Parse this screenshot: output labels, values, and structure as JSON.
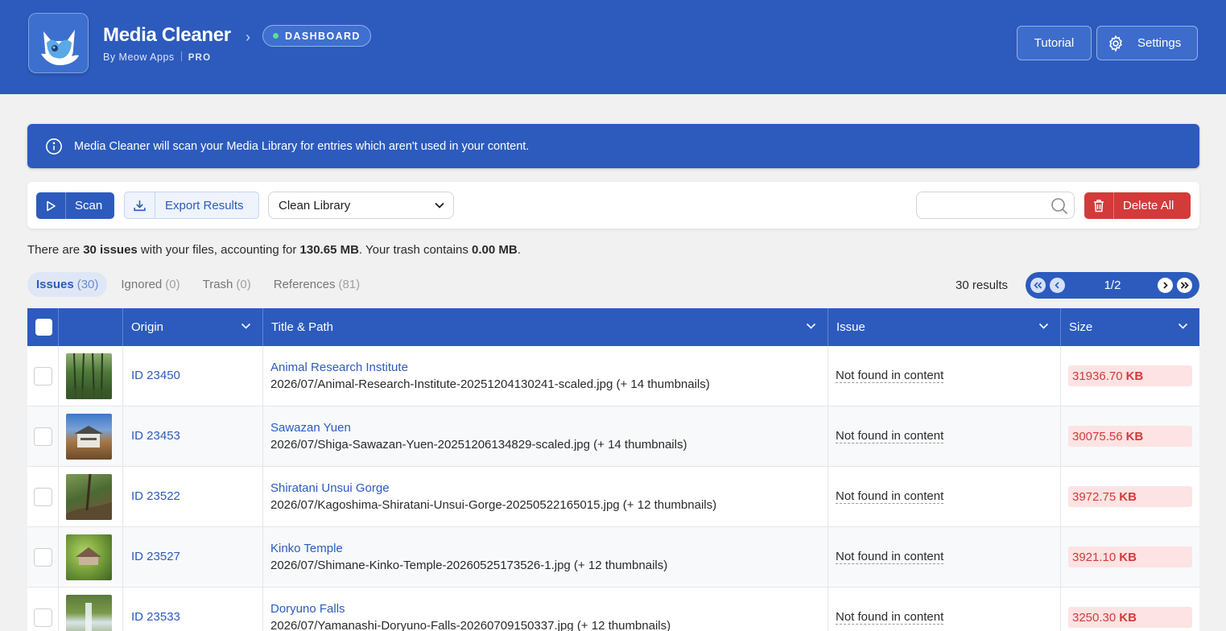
{
  "header": {
    "app_title": "Media Cleaner",
    "by": "By Meow Apps",
    "edition": "PRO",
    "breadcrumb_chevron": "›",
    "badge": "DASHBOARD",
    "tutorial_label": "Tutorial",
    "settings_label": "Settings",
    "logo_icon": "cat-logo-icon",
    "colors": {
      "primary": "#2c5bbd",
      "danger": "#d33a3a",
      "badge_dot": "#5ee08e"
    }
  },
  "banner": {
    "text": "Media Cleaner will scan your Media Library for entries which aren't used in your content."
  },
  "toolbar": {
    "scan_label": "Scan",
    "export_label": "Export Results",
    "clean_select_value": "Clean Library",
    "search_placeholder": "",
    "delete_all_label": "Delete All"
  },
  "summary": {
    "prefix": "There are ",
    "issues": "30 issues",
    "mid": " with your files, accounting for ",
    "size": "130.65 MB",
    "mid2": ". Your trash contains ",
    "trash": "0.00 MB",
    "suffix": "."
  },
  "tabs": [
    {
      "label": "Issues",
      "count": "(30)"
    },
    {
      "label": "Ignored",
      "count": "(0)"
    },
    {
      "label": "Trash",
      "count": "(0)"
    },
    {
      "label": "References",
      "count": "(81)"
    }
  ],
  "results": {
    "count_text": "30 results",
    "page_label": "1/2"
  },
  "table": {
    "columns": [
      "Origin",
      "Title & Path",
      "Issue",
      "Size"
    ],
    "rows": [
      {
        "id": "ID 23450",
        "title": "Animal Research Institute",
        "path": "2026/07/Animal-Research-Institute-20251204130241-scaled.jpg (+ 14 thumbnails)",
        "issue": "Not found in content",
        "size": "31936.70",
        "unit": "KB"
      },
      {
        "id": "ID 23453",
        "title": "Sawazan Yuen",
        "path": "2026/07/Shiga-Sawazan-Yuen-20251206134829-scaled.jpg (+ 14 thumbnails)",
        "issue": "Not found in content",
        "size": "30075.56",
        "unit": "KB"
      },
      {
        "id": "ID 23522",
        "title": "Shiratani Unsui Gorge",
        "path": "2026/07/Kagoshima-Shiratani-Unsui-Gorge-20250522165015.jpg (+ 12 thumbnails)",
        "issue": "Not found in content",
        "size": "3972.75",
        "unit": "KB"
      },
      {
        "id": "ID 23527",
        "title": "Kinko Temple",
        "path": "2026/07/Shimane-Kinko-Temple-20260525173526-1.jpg (+ 12 thumbnails)",
        "issue": "Not found in content",
        "size": "3921.10",
        "unit": "KB"
      },
      {
        "id": "ID 23533",
        "title": "Doryuno Falls",
        "path": "2026/07/Yamanashi-Doryuno-Falls-20260709150337.jpg (+ 12 thumbnails)",
        "issue": "Not found in content",
        "size": "3250.30",
        "unit": "KB"
      }
    ]
  }
}
